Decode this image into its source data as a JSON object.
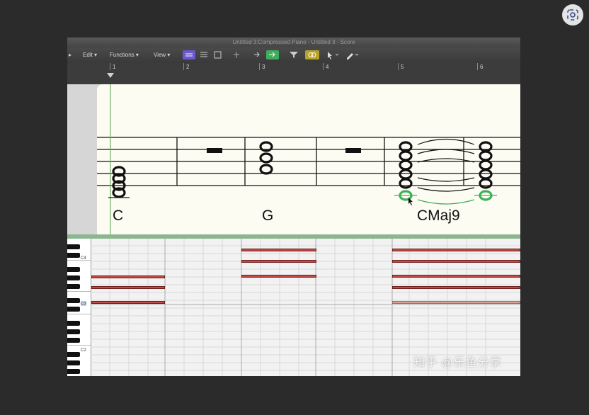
{
  "window": {
    "title": "Untitled 3:Compressed Piano - Untitled 3 - Score"
  },
  "toolbar": {
    "menus": [
      {
        "label": "Edit ▾"
      },
      {
        "label": "Functions ▾"
      },
      {
        "label": "View ▾"
      }
    ]
  },
  "ruler": {
    "bars": [
      "1",
      "2",
      "3",
      "4",
      "5",
      "6"
    ]
  },
  "score": {
    "chords": [
      {
        "name": "C"
      },
      {
        "name": "G"
      },
      {
        "name": "CMaj9"
      }
    ]
  },
  "piano_roll": {
    "key_labels": [
      "C4",
      "C3",
      "C2"
    ]
  },
  "watermark": "知乎 @乐鱼分享",
  "colors": {
    "accent_purple": "#6a5acd",
    "accent_green": "#3fae5a",
    "note_red": "#c24b47",
    "region_green": "#8bb68f"
  }
}
